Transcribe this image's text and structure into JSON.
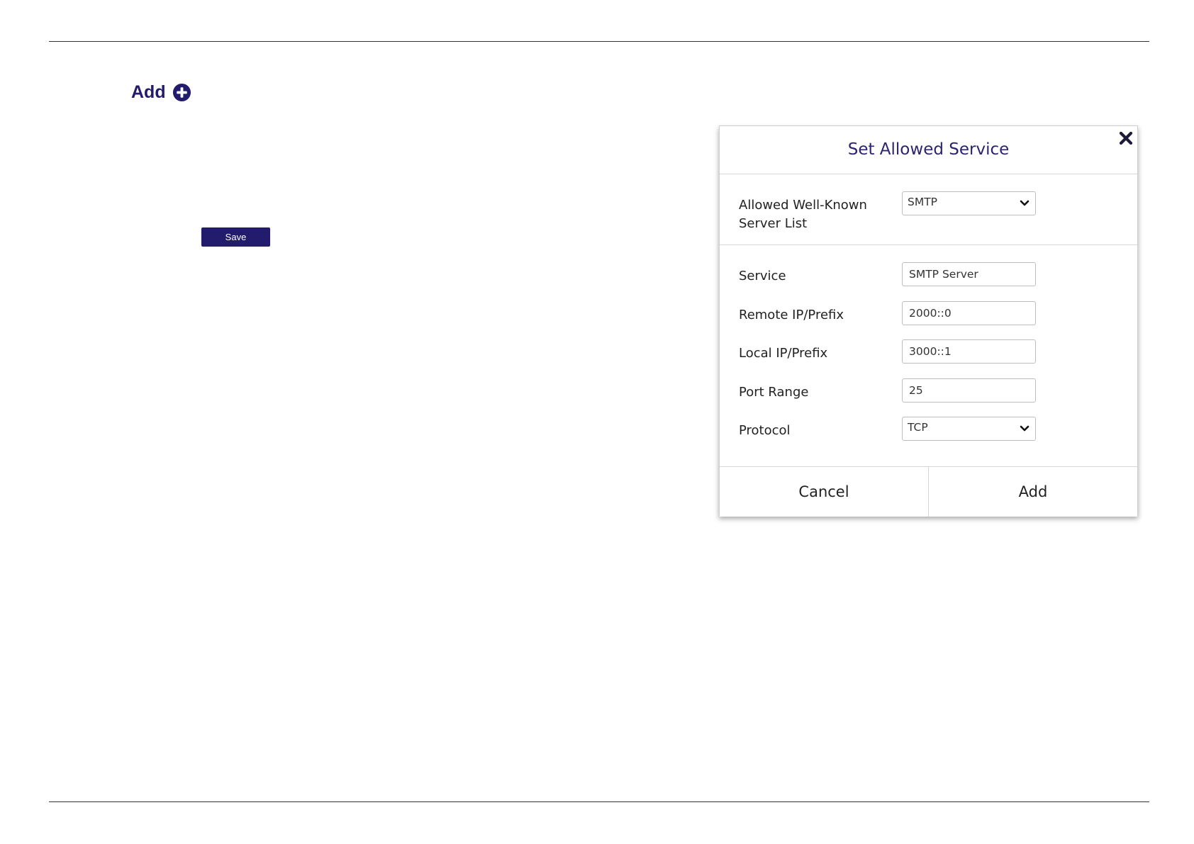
{
  "page": {
    "add_label": "Add",
    "save_label": "Save"
  },
  "colors": {
    "brand": "#231b6b",
    "title": "#2b2470"
  },
  "dialog": {
    "title": "Set Allowed Service",
    "known_server": {
      "label": "Allowed Well-Known\nServer List",
      "label_line1": "Allowed Well-Known",
      "label_line2": "Server List",
      "value": "SMTP"
    },
    "fields": [
      {
        "label": "Service",
        "value": "SMTP Server"
      },
      {
        "label": "Remote IP/Prefix",
        "value": "2000::0"
      },
      {
        "label": "Local IP/Prefix",
        "value": "3000::1"
      },
      {
        "label": "Port Range",
        "value": "25"
      }
    ],
    "protocol": {
      "label": "Protocol",
      "value": "TCP"
    },
    "cancel_label": "Cancel",
    "add_label": "Add"
  },
  "icons": {
    "add": "plus-circle-icon",
    "close": "close-icon",
    "dropdown": "chevron-down-icon"
  }
}
